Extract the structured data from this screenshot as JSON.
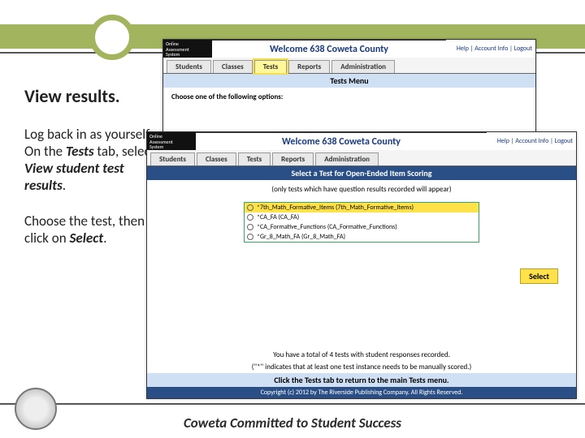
{
  "sidebar": {
    "title": "View results.",
    "para1_a": "Log back in as yourself.  On the ",
    "para1_em1": "Tests",
    "para1_b": " tab, select ",
    "para1_em2": "View student test results",
    "para1_c": ".",
    "para2_a": "Choose the test, then click on ",
    "para2_em": "Select",
    "para2_b": "."
  },
  "tagline": "Coweta Committed to Student Success",
  "app": {
    "logo_l1": "Online",
    "logo_l2": "Assessment",
    "logo_l3": "System",
    "welcome": "Welcome 638 Coweta County",
    "acct_help": "Help",
    "acct_info": "Account Info",
    "acct_logout": "Logout",
    "tabs": {
      "students": "Students",
      "classes": "Classes",
      "tests": "Tests",
      "reports": "Reports",
      "admin": "Administration"
    }
  },
  "shot1": {
    "menu": "Tests Menu",
    "choose": "Choose one of the following options:"
  },
  "shot2": {
    "heading": "Select a Test for Open-Ended Item Scoring",
    "note": "(only tests which have question results recorded will appear)",
    "tests": [
      "*7th_Math_Formative_Items (7th_Math_Formative_Items)",
      "*CA_FA (CA_FA)",
      "*CA_Formative_Functions (CA_Formative_Functions)",
      "*Gr_8_Math_FA (Gr_8_Math_FA)"
    ],
    "select": "Select",
    "msg1": "You have a total of 4 tests with student responses recorded.",
    "msg2": "(\"*\" indicates that at least one test instance needs to be manually scored.)",
    "return": "Click the Tests tab to return to the main Tests menu.",
    "copyright": "Copyright (c) 2012 by The Riverside Publishing Company. All Rights Reserved."
  }
}
